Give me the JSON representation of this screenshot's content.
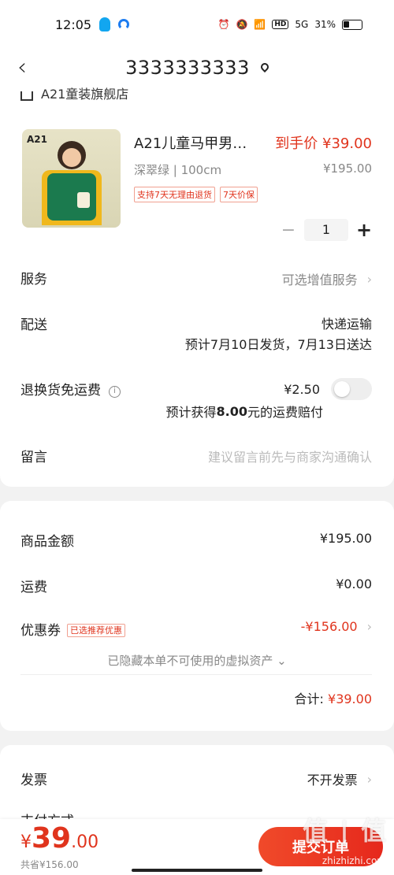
{
  "status_bar": {
    "time": "12:05",
    "signal": "5G",
    "hd": "HD",
    "battery": "31%"
  },
  "nav": {
    "title": "3333333333"
  },
  "store": {
    "name": "A21童装旗舰店"
  },
  "product": {
    "brand": "A21",
    "title": "A21儿童马甲男…",
    "deal_price": "到手价 ¥39.00",
    "spec": "深翠绿 | 100cm",
    "original_price": "¥195.00",
    "tags": [
      "支持7天无理由退货",
      "7天价保"
    ],
    "quantity": "1"
  },
  "service": {
    "label": "服务",
    "value": "可选增值服务"
  },
  "delivery": {
    "label": "配送",
    "method": "快递运输",
    "eta": "预计7月10日发货，7月13日送达"
  },
  "return_insurance": {
    "label": "退换货免运费",
    "price": "¥2.50",
    "note_prefix": "预计获得",
    "note_amount": "8.00",
    "note_suffix": "元的运费赔付",
    "enabled": false
  },
  "message": {
    "label": "留言",
    "placeholder": "建议留言前先与商家沟通确认"
  },
  "summary": {
    "goods_label": "商品金额",
    "goods_value": "¥195.00",
    "shipping_label": "运费",
    "shipping_value": "¥0.00",
    "coupon_label": "优惠券",
    "coupon_tag": "已选推荐优惠",
    "coupon_value": "-¥156.00",
    "hidden_assets": "已隐藏本单不可使用的虚拟资产",
    "total_label": "合计:",
    "total_value": "¥39.00"
  },
  "invoice": {
    "label": "发票",
    "value": "不开发票"
  },
  "payment": {
    "label": "支付方式"
  },
  "bottom": {
    "currency": "¥",
    "price_int": "39",
    "price_dec": ".00",
    "saved": "共省¥156.00",
    "submit": "提交订单"
  },
  "watermark": {
    "text": "值 | 值",
    "url": "zhizhizhi.com"
  },
  "colors": {
    "accent": "#e0341d"
  }
}
